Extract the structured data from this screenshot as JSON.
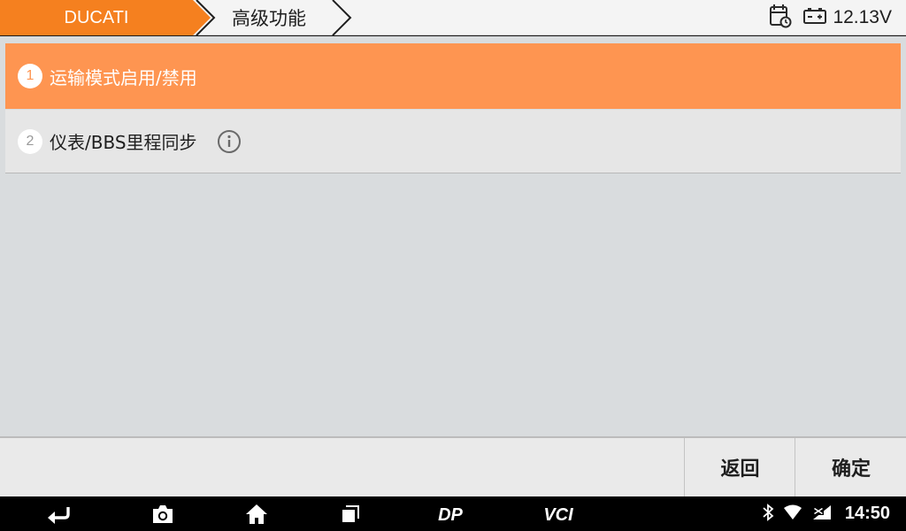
{
  "header": {
    "breadcrumb": [
      {
        "label": "DUCATI"
      },
      {
        "label": "高级功能"
      }
    ],
    "voltage": "12.13V",
    "icons": [
      "calendar-clock-icon",
      "battery-icon"
    ]
  },
  "menu": {
    "items": [
      {
        "number": "1",
        "label": "运输模式启用/禁用",
        "selected": true
      },
      {
        "number": "2",
        "label": "仪表/BBS里程同步",
        "info_icon": "info-icon"
      }
    ]
  },
  "footer": {
    "back_label": "返回",
    "ok_label": "确定"
  },
  "navbar": {
    "icons": [
      "back-icon",
      "camera-icon",
      "home-icon",
      "recent-apps-icon",
      "dp-icon",
      "vci-icon"
    ],
    "dp_label": "DP",
    "vci_label": "VCI",
    "status_icons": [
      "bluetooth-icon",
      "wifi-icon",
      "signal-icon"
    ],
    "time": "14:50"
  },
  "colors": {
    "accent": "#fe9551",
    "crumb_active": "#f5801f",
    "background": "#d9dcde"
  }
}
